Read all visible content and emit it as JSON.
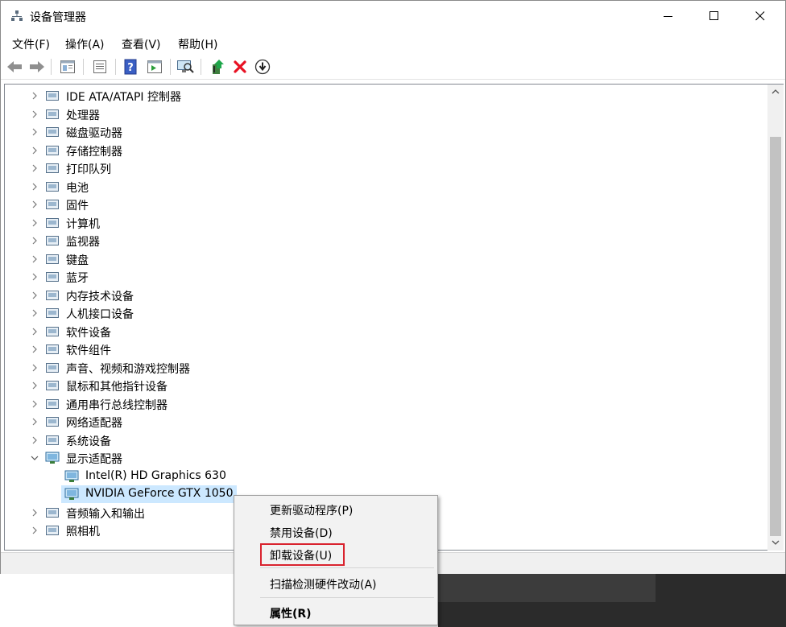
{
  "window": {
    "title": "设备管理器",
    "controls": {
      "minimize": "—",
      "maximize": "☐",
      "close": "✕"
    }
  },
  "menu": [
    "文件(F)",
    "操作(A)",
    "查看(V)",
    "帮助(H)"
  ],
  "toolbar": {
    "icons": [
      "back-icon",
      "forward-icon",
      "console-tree-icon",
      "properties-icon",
      "help-icon",
      "action-pane-icon",
      "scan-hardware-icon",
      "update-driver-icon",
      "uninstall-icon",
      "download-icon"
    ]
  },
  "tree": {
    "items": [
      {
        "label": "IDE ATA/ATAPI 控制器",
        "expanded": false,
        "icon": "ide-controller-icon"
      },
      {
        "label": "处理器",
        "expanded": false,
        "icon": "processor-icon"
      },
      {
        "label": "磁盘驱动器",
        "expanded": false,
        "icon": "disk-drive-icon"
      },
      {
        "label": "存储控制器",
        "expanded": false,
        "icon": "storage-controller-icon"
      },
      {
        "label": "打印队列",
        "expanded": false,
        "icon": "printer-icon"
      },
      {
        "label": "电池",
        "expanded": false,
        "icon": "battery-icon"
      },
      {
        "label": "固件",
        "expanded": false,
        "icon": "firmware-icon"
      },
      {
        "label": "计算机",
        "expanded": false,
        "icon": "computer-icon"
      },
      {
        "label": "监视器",
        "expanded": false,
        "icon": "monitor-icon"
      },
      {
        "label": "键盘",
        "expanded": false,
        "icon": "keyboard-icon"
      },
      {
        "label": "蓝牙",
        "expanded": false,
        "icon": "bluetooth-icon"
      },
      {
        "label": "内存技术设备",
        "expanded": false,
        "icon": "memory-device-icon"
      },
      {
        "label": "人机接口设备",
        "expanded": false,
        "icon": "hid-icon"
      },
      {
        "label": "软件设备",
        "expanded": false,
        "icon": "software-device-icon"
      },
      {
        "label": "软件组件",
        "expanded": false,
        "icon": "software-component-icon"
      },
      {
        "label": "声音、视频和游戏控制器",
        "expanded": false,
        "icon": "sound-icon"
      },
      {
        "label": "鼠标和其他指针设备",
        "expanded": false,
        "icon": "mouse-icon"
      },
      {
        "label": "通用串行总线控制器",
        "expanded": false,
        "icon": "usb-icon"
      },
      {
        "label": "网络适配器",
        "expanded": false,
        "icon": "network-adapter-icon"
      },
      {
        "label": "系统设备",
        "expanded": false,
        "icon": "system-device-icon"
      },
      {
        "label": "显示适配器",
        "expanded": true,
        "icon": "display-adapter-icon"
      },
      {
        "label": "Intel(R) HD Graphics 630",
        "child": true,
        "icon": "display-adapter-icon"
      },
      {
        "label": "NVIDIA GeForce GTX 1050",
        "child": true,
        "selected": true,
        "icon": "display-adapter-icon"
      },
      {
        "label": "音频输入和输出",
        "expanded": false,
        "icon": "audio-icon"
      },
      {
        "label": "照相机",
        "expanded": false,
        "icon": "camera-icon"
      }
    ]
  },
  "context_menu": {
    "update_driver": "更新驱动程序(P)",
    "disable_device": "禁用设备(D)",
    "uninstall_device": "卸载设备(U)",
    "scan_hardware": "扫描检测硬件改动(A)",
    "properties": "属性(R)"
  },
  "colors": {
    "selection": "#cce8ff",
    "highlight_box": "#d9232e",
    "uninstall_red": "#e81123"
  }
}
